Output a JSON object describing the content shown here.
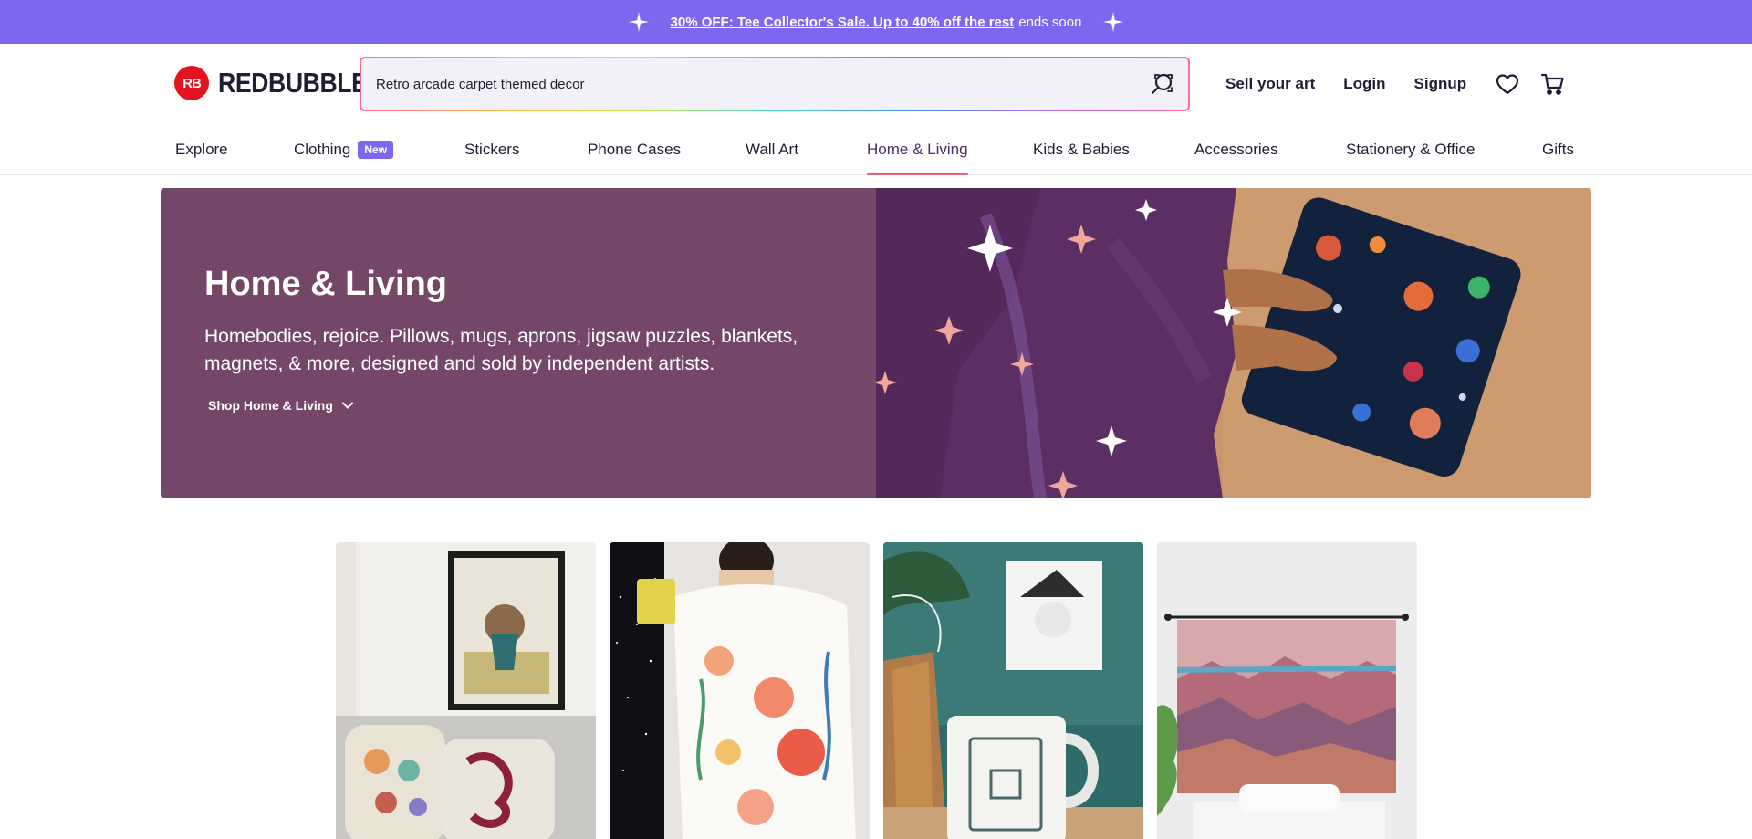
{
  "promo": {
    "link_text": "30% OFF: Tee Collector's Sale. Up to 40% off the rest",
    "suffix": "ends soon"
  },
  "header": {
    "logo_mark": "RB",
    "logo_text": "REDBUBBLE",
    "search_value": "Retro arcade carpet themed decor",
    "sell": "Sell your art",
    "login": "Login",
    "signup": "Signup"
  },
  "nav": {
    "items": [
      {
        "label": "Explore"
      },
      {
        "label": "Clothing",
        "badge": "New"
      },
      {
        "label": "Stickers"
      },
      {
        "label": "Phone Cases"
      },
      {
        "label": "Wall Art"
      },
      {
        "label": "Home & Living",
        "active": true
      },
      {
        "label": "Kids & Babies"
      },
      {
        "label": "Accessories"
      },
      {
        "label": "Stationery & Office"
      },
      {
        "label": "Gifts"
      }
    ]
  },
  "hero": {
    "title": "Home & Living",
    "description": "Homebodies, rejoice. Pillows, mugs, aprons, jigsaw puzzles, blankets, magnets, & more, designed and sold by independent artists.",
    "shop_label": "Shop Home & Living"
  },
  "icons": {
    "promo": "sparkle-icon",
    "search": "search-icon",
    "wishlist": "heart-icon",
    "cart": "cart-icon",
    "shop_toggle": "chevron-down-icon"
  },
  "colors": {
    "promo_bg": "#7b68ee",
    "hero_bg": "#744769",
    "brand_red": "#e41321",
    "nav_active_underline": "#e3647b"
  }
}
